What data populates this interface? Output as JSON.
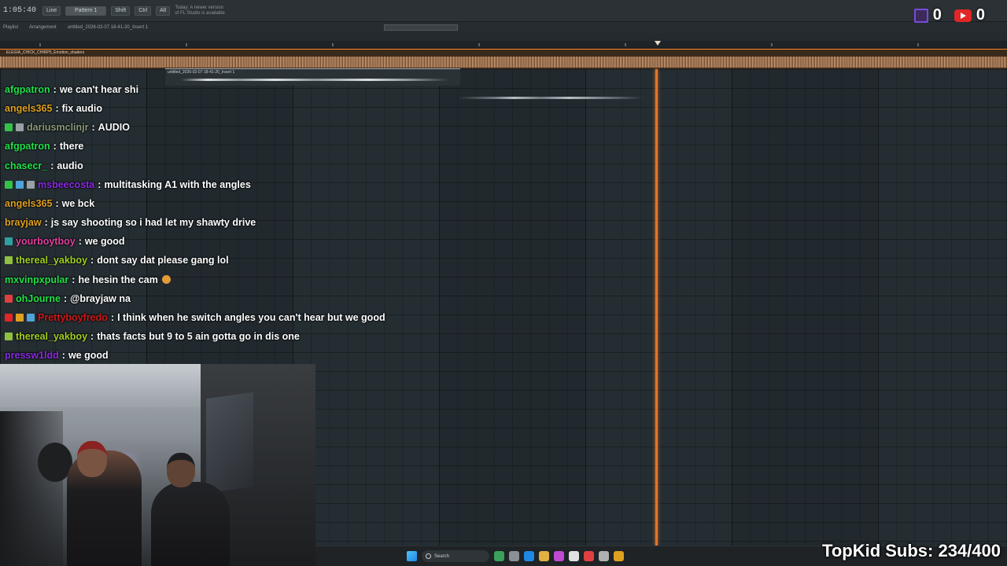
{
  "daw": {
    "time": "1:05:40",
    "toolbar": {
      "mode_label": "Line",
      "pattern_label": "Pattern 1",
      "shift_label": "Shift",
      "ctrl_label": "Ctrl",
      "alt_label": "Alt",
      "update_note": "Today: A newer version of FL Studio is available"
    },
    "subbar": {
      "playlist_label": "Playlist",
      "arrangement_label": "Arrangement",
      "breadcrumb": "untitled_2026-02-07 18-41-20_Insert 1"
    },
    "clips": {
      "main_title": "ELEGIA_CHICK_CHIRP5_Emotion_shaders",
      "small_title": "untitled_2026-02-07 18-41-20_Insert 1"
    }
  },
  "chat": [
    {
      "user": "afgpatron",
      "color": "#22e04a",
      "message": "we can't hear shi",
      "badges": []
    },
    {
      "user": "angels365",
      "color": "#e0a020",
      "message": "fix audio",
      "badges": []
    },
    {
      "user": "dariusmclinjr",
      "color": "#8a9a7a",
      "message": "AUDIO",
      "badges": [
        "#35c04a",
        "#9aa0a4"
      ]
    },
    {
      "user": "afgpatron",
      "color": "#22e04a",
      "message": "there",
      "badges": []
    },
    {
      "user": "chasecr_",
      "color": "#22e04a",
      "message": "audio",
      "badges": []
    },
    {
      "user": "msbeecosta",
      "color": "#8a2be2",
      "message": "multitasking A1 with the angles",
      "badges": [
        "#35c04a",
        "#4fa3d8",
        "#9aa0a4"
      ]
    },
    {
      "user": "angels365",
      "color": "#e0a020",
      "message": "we bck",
      "badges": []
    },
    {
      "user": "brayjaw",
      "color": "#e0a020",
      "message": "js say shooting so i had let my shawty drive",
      "badges": []
    },
    {
      "user": "yourboytboy",
      "color": "#e040a0",
      "message": "we good",
      "badges": [
        "#30a0a0"
      ]
    },
    {
      "user": "thereal_yakboy",
      "color": "#a0d020",
      "message": "dont say dat please gang lol",
      "badges": [
        "#8fc040"
      ]
    },
    {
      "user": "mxvinpxpular",
      "color": "#22e04a",
      "message": "he hesin the cam",
      "badges": [],
      "emoji": true
    },
    {
      "user": "ohJourne",
      "color": "#22e04a",
      "message": "@brayjaw na",
      "badges": [
        "#e04040"
      ]
    },
    {
      "user": "Prettyboyfredo",
      "color": "#d01818",
      "message": "I think when he switch angles you can't hear but we good",
      "badges": [
        "#e02626",
        "#e0a020",
        "#4fa3d8"
      ]
    },
    {
      "user": "thereal_yakboy",
      "color": "#a0d020",
      "message": "thats facts but 9 to 5 ain gotta go in dis one",
      "badges": [
        "#8fc040"
      ]
    },
    {
      "user": "pressw1ldd",
      "color": "#8a2be2",
      "message": "we good",
      "badges": []
    }
  ],
  "counters": {
    "twitch_count": "0",
    "youtube_count": "0"
  },
  "subs_goal": "TopKid Subs: 234/400",
  "taskbar": {
    "search_placeholder": "Search",
    "app_colors": [
      "#3aa05a",
      "#8a9096",
      "#1e88e5",
      "#e0b040",
      "#c04ad0",
      "#e0e0e0",
      "#e04040",
      "#b0b0b0",
      "#e0a020"
    ]
  }
}
